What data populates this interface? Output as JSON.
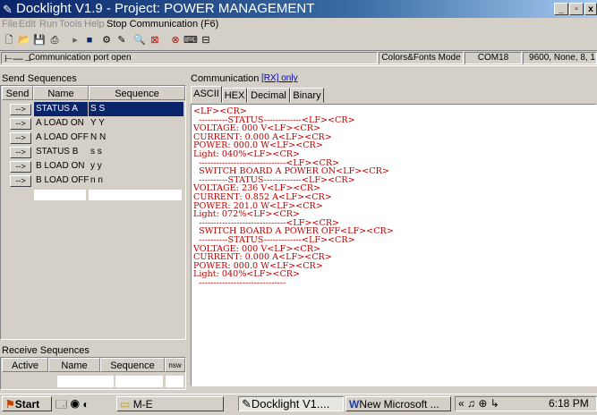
{
  "window": {
    "title": "Docklight V1.9 - Project: POWER MANAGEMENT"
  },
  "menu": [
    "File",
    "Edit",
    "Run",
    "Tools",
    "Help",
    "Stop Communication  (F6)"
  ],
  "statusbar": {
    "port": "Communication port open",
    "mode": "Colors&Fonts Mode",
    "com": "COM18",
    "settings": "9600, None, 8, 1"
  },
  "send": {
    "title": "Send Sequences",
    "columns": [
      "Send",
      "Name",
      "Sequence"
    ],
    "button_label": "-->",
    "rows": [
      {
        "name": "STATUS A",
        "seq": "S S"
      },
      {
        "name": "A LOAD ON",
        "seq": "Y Y"
      },
      {
        "name": "A LOAD OFF",
        "seq": "N N"
      },
      {
        "name": "STATUS B",
        "seq": "s s"
      },
      {
        "name": "B LOAD ON",
        "seq": "y y"
      },
      {
        "name": "B LOAD OFF",
        "seq": "n n"
      }
    ]
  },
  "receive": {
    "title": "Receive Sequences",
    "columns": [
      "Active",
      "Name",
      "Sequence",
      "nsw"
    ]
  },
  "comm": {
    "label": "Communication",
    "link": "[RX] only",
    "tabs": [
      "ASCII",
      "HEX",
      "Decimal",
      "Binary"
    ]
  },
  "log": [
    {
      "t": "<LF><CR>",
      "g": false
    },
    {
      "t": "  ----------STATUS-------------<LF><CR>",
      "g": false
    },
    {
      "t": "VOLTAGE: 000 V<LF><CR>",
      "g": false
    },
    {
      "t": "CURRENT: 0.000 A<LF><CR>",
      "g": false
    },
    {
      "t": "POWER: 000.0 W<LF><CR>",
      "g": false
    },
    {
      "t": "Light: 040%<LF><CR>",
      "g": false
    },
    {
      "t": "  ------------------------------<LF><CR>",
      "g": false
    },
    {
      "t": "  SWITCH BOARD A POWER ON<LF><CR>",
      "g": false
    },
    {
      "t": "  ----------STATUS-------------<LF><CR>",
      "g": false
    },
    {
      "t": "VOLTAGE: 236 V<LF><CR>",
      "g": false
    },
    {
      "t": "CURRENT: 0.852 A<LF><CR>",
      "g": false
    },
    {
      "t": "POWER: 201.0 W<LF><CR>",
      "g": false
    },
    {
      "t": "Light: 072%<LF><CR>",
      "g": false
    },
    {
      "t": "  ------------------------------<LF><CR>",
      "g": false
    },
    {
      "t": "  SWITCH BOARD A POWER OFF<LF><CR>",
      "g": false
    },
    {
      "t": "  ----------STATUS-------------<LF><CR>",
      "g": false
    },
    {
      "t": "VOLTAGE: 000 V<LF><CR>",
      "g": false
    },
    {
      "t": "CURRENT: 0.000 A<LF><CR>",
      "g": false
    },
    {
      "t": "POWER: 000.0 W<LF><CR>",
      "g": false
    },
    {
      "t": "Light: 040%<LF><CR>",
      "g": false
    },
    {
      "t": "  ------------------------------",
      "g": false
    }
  ],
  "taskbar": {
    "start": "Start",
    "item1": "M-E",
    "item2": "Docklight V1....",
    "item3": "New Microsoft ...",
    "clock": "6:18 PM"
  },
  "colors": {
    "log_text": "#c00000",
    "selection": "#0a246a",
    "title_bar": "#0a246a"
  }
}
